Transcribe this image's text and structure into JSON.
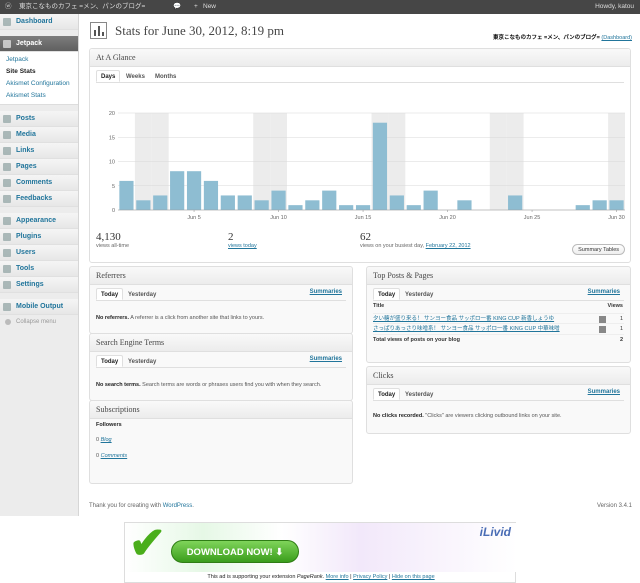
{
  "adminbar": {
    "site_name": "東京こなものカフェ =メン、パンのブログ=",
    "new_label": "New",
    "howdy": "Howdy, katou"
  },
  "sidebar": {
    "items_top": [
      {
        "label": "Dashboard",
        "icon": "dashboard-icon"
      }
    ],
    "jetpack": {
      "label": "Jetpack",
      "icon": "jetpack-icon"
    },
    "submenu": [
      "Jetpack",
      "Site Stats",
      "Akismet Configuration",
      "Akismet Stats"
    ],
    "items_mid": [
      {
        "label": "Posts",
        "icon": "pushpin-icon"
      },
      {
        "label": "Media",
        "icon": "media-icon"
      },
      {
        "label": "Links",
        "icon": "links-icon"
      },
      {
        "label": "Pages",
        "icon": "pages-icon"
      },
      {
        "label": "Comments",
        "icon": "comments-icon"
      },
      {
        "label": "Feedbacks",
        "icon": "feedback-icon"
      }
    ],
    "items_bottom": [
      {
        "label": "Appearance",
        "icon": "appearance-icon"
      },
      {
        "label": "Plugins",
        "icon": "plugins-icon"
      },
      {
        "label": "Users",
        "icon": "users-icon"
      },
      {
        "label": "Tools",
        "icon": "tools-icon"
      },
      {
        "label": "Settings",
        "icon": "settings-icon"
      }
    ],
    "mobile": {
      "label": "Mobile Output",
      "icon": "mobile-icon"
    },
    "collapse": "Collapse menu"
  },
  "header": {
    "title": "Stats for June 30, 2012, 8:19 pm",
    "blog_name": "東京こなものカフェ =メン、パンのブログ=",
    "dashboard_link": "(Dashboard)"
  },
  "at_a_glance": {
    "title": "At A Glance",
    "tabs": [
      "Days",
      "Weeks",
      "Months"
    ],
    "stats": [
      {
        "value": "4,130",
        "label": "views all-time"
      },
      {
        "value": "2",
        "label": "views today"
      },
      {
        "value": "62",
        "label_prefix": "views on your busiest day, ",
        "label_link": "February 22, 2012"
      }
    ],
    "summary_tables": "Summary Tables"
  },
  "chart_data": {
    "type": "bar",
    "x_tick_labels": [
      "Jun 5",
      "Jun 10",
      "Jun 15",
      "Jun 20",
      "Jun 25",
      "Jun 30"
    ],
    "x_tick_days": [
      5,
      10,
      15,
      20,
      25,
      30
    ],
    "days": [
      1,
      2,
      3,
      4,
      5,
      6,
      7,
      8,
      9,
      10,
      11,
      12,
      13,
      14,
      15,
      16,
      17,
      18,
      19,
      20,
      21,
      22,
      23,
      24,
      25,
      26,
      27,
      28,
      29,
      30
    ],
    "values": [
      6,
      2,
      3,
      8,
      8,
      6,
      3,
      3,
      2,
      4,
      1,
      2,
      4,
      1,
      1,
      18,
      3,
      1,
      4,
      0,
      2,
      0,
      0,
      3,
      0,
      0,
      0,
      1,
      2,
      2
    ],
    "weekend_days": [
      2,
      3,
      9,
      10,
      16,
      17,
      23,
      24,
      30
    ],
    "ylim": [
      0,
      20
    ],
    "y_ticks": [
      0,
      5,
      10,
      15,
      20
    ],
    "bar_color": "#8ebdd2",
    "grid": true
  },
  "referrers": {
    "title": "Referrers",
    "tabs": [
      "Today",
      "Yesterday"
    ],
    "summaries": "Summaries",
    "empty_bold": "No referrers.",
    "empty_text": " A referrer is a click from another site that links to yours."
  },
  "search_terms": {
    "title": "Search Engine Terms",
    "tabs": [
      "Today",
      "Yesterday"
    ],
    "summaries": "Summaries",
    "empty_bold": "No search terms.",
    "empty_text": " Search terms are words or phrases users find you with when they search."
  },
  "subscriptions": {
    "title": "Subscriptions",
    "followers": "Followers",
    "rows": [
      {
        "count": "0",
        "label": "Blog"
      },
      {
        "count": "0",
        "label": "Comments"
      }
    ]
  },
  "top_posts": {
    "title": "Top Posts & Pages",
    "tabs": [
      "Today",
      "Yesterday"
    ],
    "summaries": "Summaries",
    "col_title": "Title",
    "col_views": "Views",
    "rows": [
      {
        "title": "夕い糖が盛り来る！ サンヨー食品 サッポロ一番 KING CUP 新香しょうゆ",
        "views": "1"
      },
      {
        "title": "さっぱりあっさり味噌系！ サンヨー食品 サッポロ一番 KING CUP 中華味噌",
        "views": "1"
      }
    ],
    "total_label": "Total views of posts on your blog",
    "total_value": "2"
  },
  "clicks": {
    "title": "Clicks",
    "tabs": [
      "Today",
      "Yesterday"
    ],
    "summaries": "Summaries",
    "empty_bold": "No clicks recorded.",
    "empty_text": " \"Clicks\" are viewers clicking outbound links on your site."
  },
  "footer": {
    "thanks": "Thank you for creating with ",
    "wp_link": "WordPress",
    "version": "Version 3.4.1"
  },
  "ad": {
    "button": "DOWNLOAD NOW!",
    "logo": "iLivid",
    "note_prefix": "This ad is supporting your extension ",
    "note_ext": "PageRank",
    "note_more": "More info",
    "note_privacy": "Privacy Policy",
    "note_hide": "Hide on this page"
  },
  "colors": {
    "link": "#21759b",
    "adminbar": "#464646",
    "accent_green": "#4aae1b"
  }
}
